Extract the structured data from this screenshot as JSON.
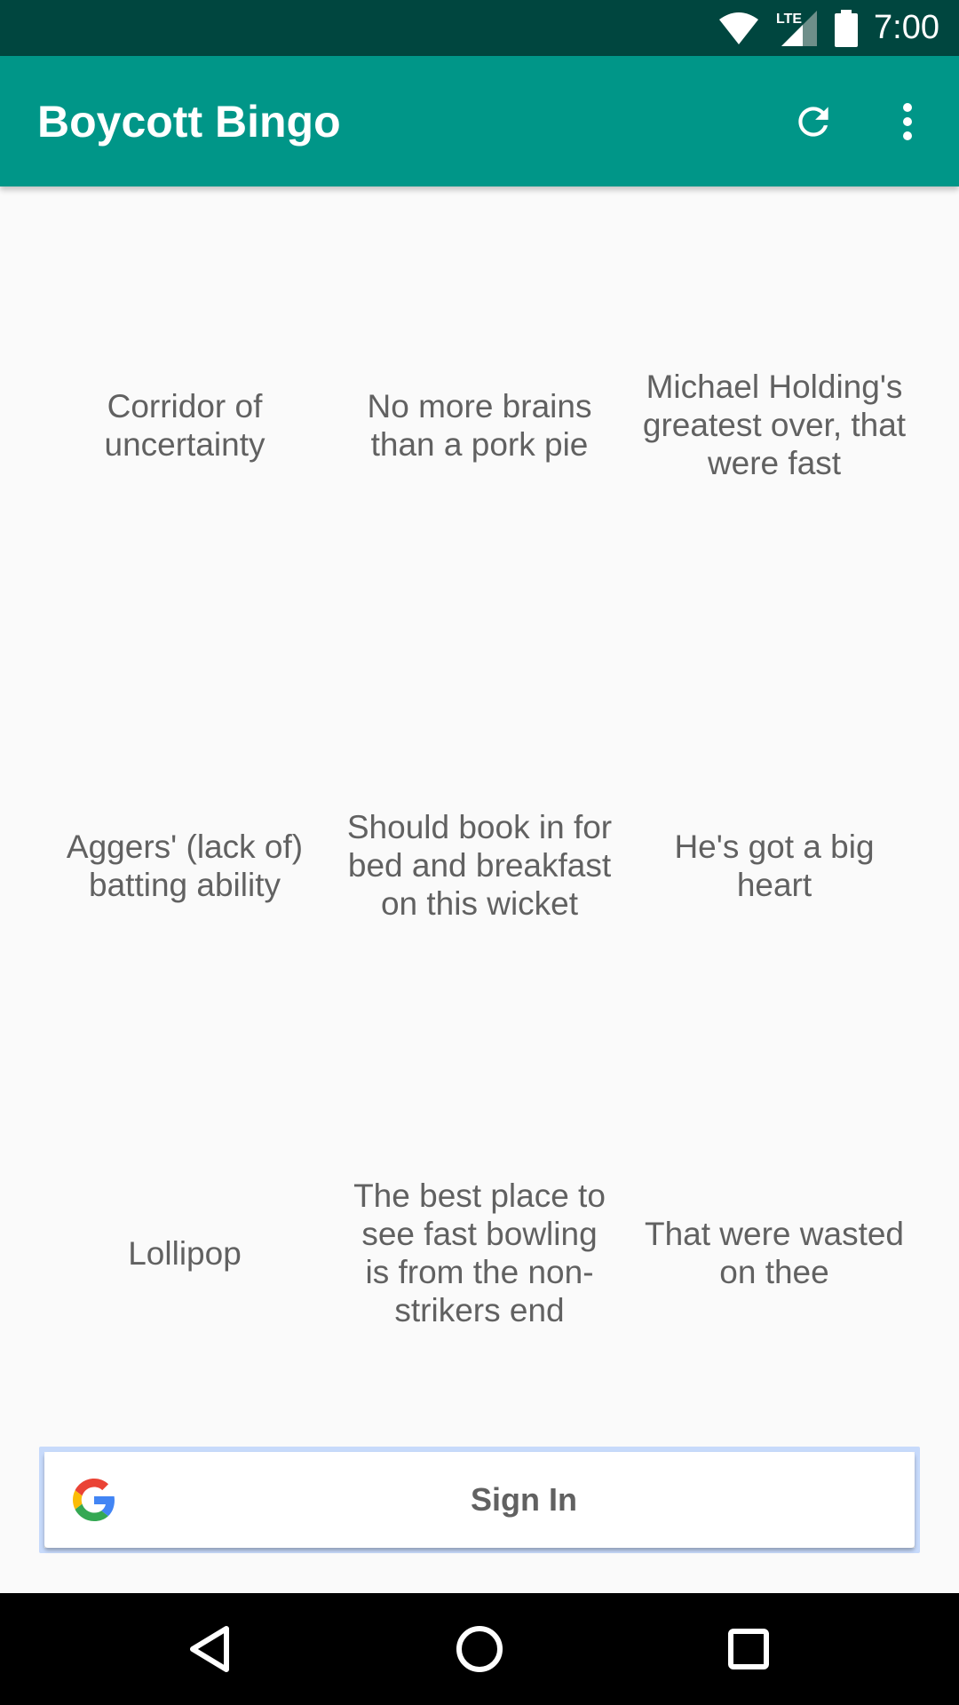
{
  "status_bar": {
    "time": "7:00",
    "network": "LTE",
    "icons": [
      "wifi-icon",
      "signal-icon",
      "battery-icon"
    ]
  },
  "app_bar": {
    "title": "Boycott Bingo",
    "actions": [
      "refresh-icon",
      "more-vert-icon"
    ],
    "color": "#009688"
  },
  "bingo": {
    "cells": [
      "Corridor of uncertainty",
      "No more brains than a pork pie",
      "Michael Holding's greatest over, that were fast",
      "Aggers' (lack of) batting ability",
      "Should book in for bed and breakfast on this wicket",
      "He's got a big heart",
      "Lollipop",
      "The best place to see fast bowling is from the non-strikers end",
      "That were wasted on thee"
    ]
  },
  "sign_in": {
    "label": "Sign In",
    "icon": "google-icon"
  },
  "nav_bar": {
    "buttons": [
      "back-icon",
      "home-icon",
      "recents-icon"
    ]
  }
}
